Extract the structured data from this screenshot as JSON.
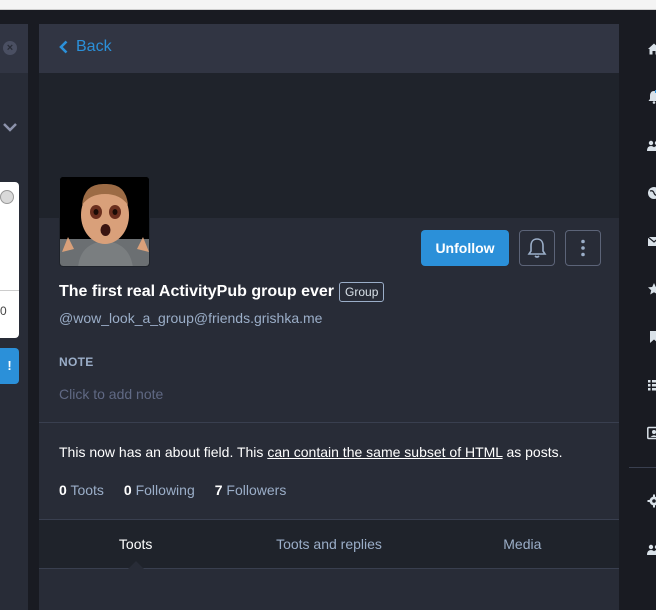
{
  "left_column": {
    "card_number": "0",
    "button_label": "!"
  },
  "header": {
    "back_label": "Back"
  },
  "profile": {
    "display_name": "The first real ActivityPub group ever",
    "badge": "Group",
    "handle": "@wow_look_a_group@friends.grishka.me",
    "follow_button": "Unfollow",
    "note_label": "NOTE",
    "note_placeholder": "Click to add note",
    "about_prefix": "This now has an about field. This ",
    "about_link": "can contain the same subset of HTML",
    "about_suffix": " as posts.",
    "counts": {
      "toots_value": "0",
      "toots_label": "Toots",
      "following_value": "0",
      "following_label": "Following",
      "followers_value": "7",
      "followers_label": "Followers"
    }
  },
  "tabs": [
    {
      "label": "Toots",
      "active": true
    },
    {
      "label": "Toots and replies",
      "active": false
    },
    {
      "label": "Media",
      "active": false
    }
  ],
  "right_nav_icons": [
    "home-icon",
    "notifications-icon",
    "local-icon",
    "federated-icon",
    "direct-icon",
    "favourites-icon",
    "bookmarks-icon",
    "lists-icon",
    "profile-directory-icon",
    "preferences-icon",
    "follow-requests-icon"
  ],
  "colors": {
    "accent": "#2b90d9",
    "column_bg": "#282c37",
    "header_bg": "#313543",
    "app_bg": "#191b22",
    "muted_text": "#9baec8"
  }
}
